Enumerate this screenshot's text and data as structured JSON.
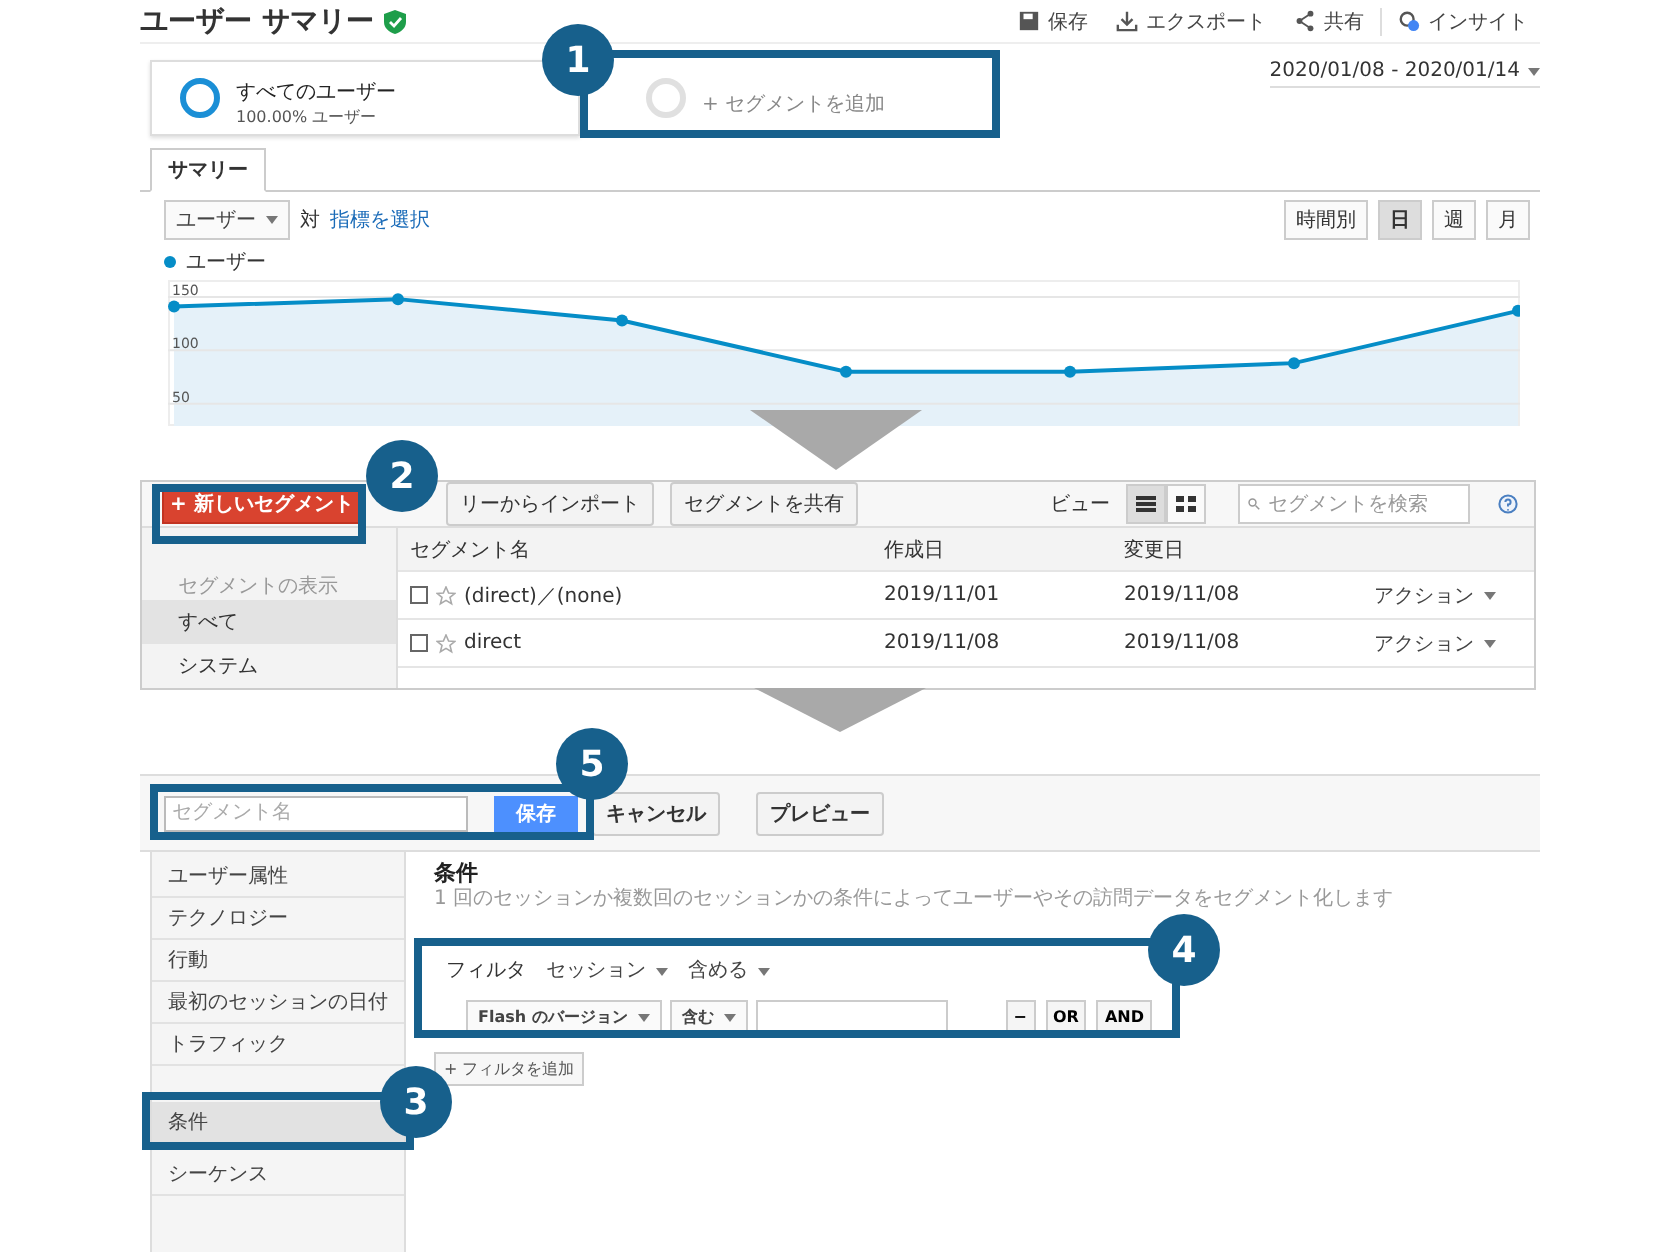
{
  "summary": {
    "title": "ユーザー サマリー",
    "actions": [
      {
        "kind": "save",
        "label": "保存"
      },
      {
        "kind": "export",
        "label": "エクスポート"
      },
      {
        "kind": "share",
        "label": "共有"
      },
      {
        "kind": "insights",
        "label": "インサイト"
      }
    ],
    "segments": [
      {
        "kind": "active",
        "label": "すべてのユーザー",
        "sub": "100.00% ユーザー"
      },
      {
        "kind": "add",
        "label": "+ セグメントを追加"
      }
    ],
    "date_range": "2020/01/08 - 2020/01/14",
    "tabs": [
      {
        "label": "サマリー",
        "selected": true
      }
    ],
    "metric_select": "ユーザー",
    "versus": "対",
    "metric_link": "指標を選択",
    "intervals": [
      {
        "label": "時間別",
        "selected": false
      },
      {
        "label": "日",
        "selected": true
      },
      {
        "label": "週",
        "selected": false
      },
      {
        "label": "月",
        "selected": false
      }
    ],
    "chart_data": {
      "type": "area",
      "yticks": [
        50,
        100,
        150
      ],
      "ylim": [
        30,
        165
      ],
      "grid": true,
      "series": [
        {
          "name": "ユーザー",
          "color": "#058dc7",
          "marker": true,
          "values": [
            141,
            148,
            128,
            80,
            80,
            88,
            137
          ]
        }
      ]
    }
  },
  "segment_list": {
    "new_button": "+ 新しいセグメント",
    "import_button": "リーからインポート",
    "share_button": "セグメントを共有",
    "view_label": "ビュー",
    "views": [
      {
        "kind": "list",
        "selected": true
      },
      {
        "kind": "grid",
        "selected": false
      }
    ],
    "search": {
      "placeholder": "セグメントを検索"
    },
    "sidebar_heading": "セグメントの表示",
    "sidebar_items": [
      {
        "label": "すべて",
        "selected": true
      },
      {
        "label": "システム",
        "selected": false
      }
    ],
    "columns": [
      "セグメント名",
      "作成日",
      "変更日"
    ],
    "rows": [
      {
        "checked": false,
        "starred": false,
        "name": "(direct)／(none)",
        "created": "2019/11/01",
        "modified": "2019/11/08",
        "action": "アクション"
      },
      {
        "checked": false,
        "starred": false,
        "name": "direct",
        "created": "2019/11/08",
        "modified": "2019/11/08",
        "action": "アクション"
      }
    ]
  },
  "segment_editor": {
    "name_field": {
      "placeholder": "セグメント名"
    },
    "save": "保存",
    "cancel": "キャンセル",
    "preview": "プレビュー",
    "sidebar_groups": [
      {
        "items": [
          {
            "label": "ユーザー属性",
            "selected": false
          },
          {
            "label": "テクノロジー",
            "selected": false
          },
          {
            "label": "行動",
            "selected": false
          },
          {
            "label": "最初のセッションの日付",
            "selected": false
          },
          {
            "label": "トラフィック",
            "selected": false
          }
        ]
      },
      {
        "items": [
          {
            "label": "条件",
            "selected": true
          },
          {
            "label": "シーケンス",
            "selected": false
          }
        ]
      }
    ],
    "heading": "条件",
    "description": "1 回のセッションか複数回のセッションかの条件によってユーザーやその訪問データをセグメント化します",
    "filter": {
      "label": "フィルタ",
      "scope": "セッション",
      "mode": "含める",
      "dimension": "Flash のバージョン",
      "operator": "含む",
      "buttons": [
        "−",
        "OR",
        "AND"
      ]
    },
    "add_filter": "+ フィルタを追加"
  },
  "callouts": [
    {
      "number": "1"
    },
    {
      "number": "2"
    },
    {
      "number": "5"
    },
    {
      "number": "4"
    },
    {
      "number": "3"
    }
  ]
}
